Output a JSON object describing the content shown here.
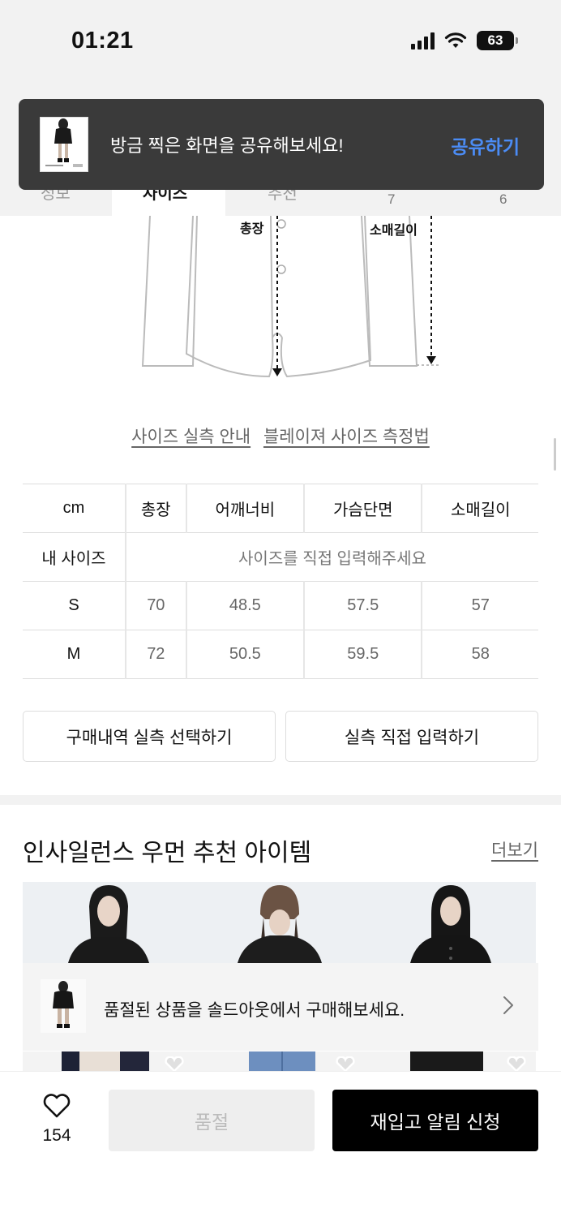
{
  "status_bar": {
    "time": "01:21",
    "battery": "63"
  },
  "tabs": {
    "items": [
      "정보",
      "사이즈",
      "추천"
    ],
    "size_numbers": [
      "7",
      "6"
    ]
  },
  "toast": {
    "message": "방금 찍은 화면을 공유해보세요!",
    "action": "공유하기"
  },
  "illustration": {
    "label_length": "총장",
    "label_sleeve": "소매길이"
  },
  "guide_links": {
    "size_guide": "사이즈 실측 안내",
    "measure_method": "블레이져 사이즈 측정법"
  },
  "size_table": {
    "unit": "cm",
    "headers": [
      "총장",
      "어깨너비",
      "가슴단면",
      "소매길이"
    ],
    "my_size_label": "내 사이즈",
    "my_size_placeholder": "사이즈를 직접 입력해주세요",
    "rows": [
      {
        "size": "S",
        "values": [
          "70",
          "48.5",
          "57.5",
          "57"
        ]
      },
      {
        "size": "M",
        "values": [
          "72",
          "50.5",
          "59.5",
          "58"
        ]
      }
    ]
  },
  "buttons": {
    "select_purchase": "구매내역 실측 선택하기",
    "manual_input": "실측 직접 입력하기"
  },
  "recommend": {
    "title": "인사일런스 우먼 추천 아이템",
    "more": "더보기"
  },
  "soldout_banner": {
    "text": "품절된 상품을 솔드아웃에서 구매해보세요."
  },
  "bottom_bar": {
    "like_count": "154",
    "soldout_label": "품절",
    "restock_label": "재입고 알림 신청"
  },
  "colors": {
    "accent_blue": "#4b8cf5",
    "dark_toast": "#3a3a3a",
    "primary_black": "#000000"
  }
}
